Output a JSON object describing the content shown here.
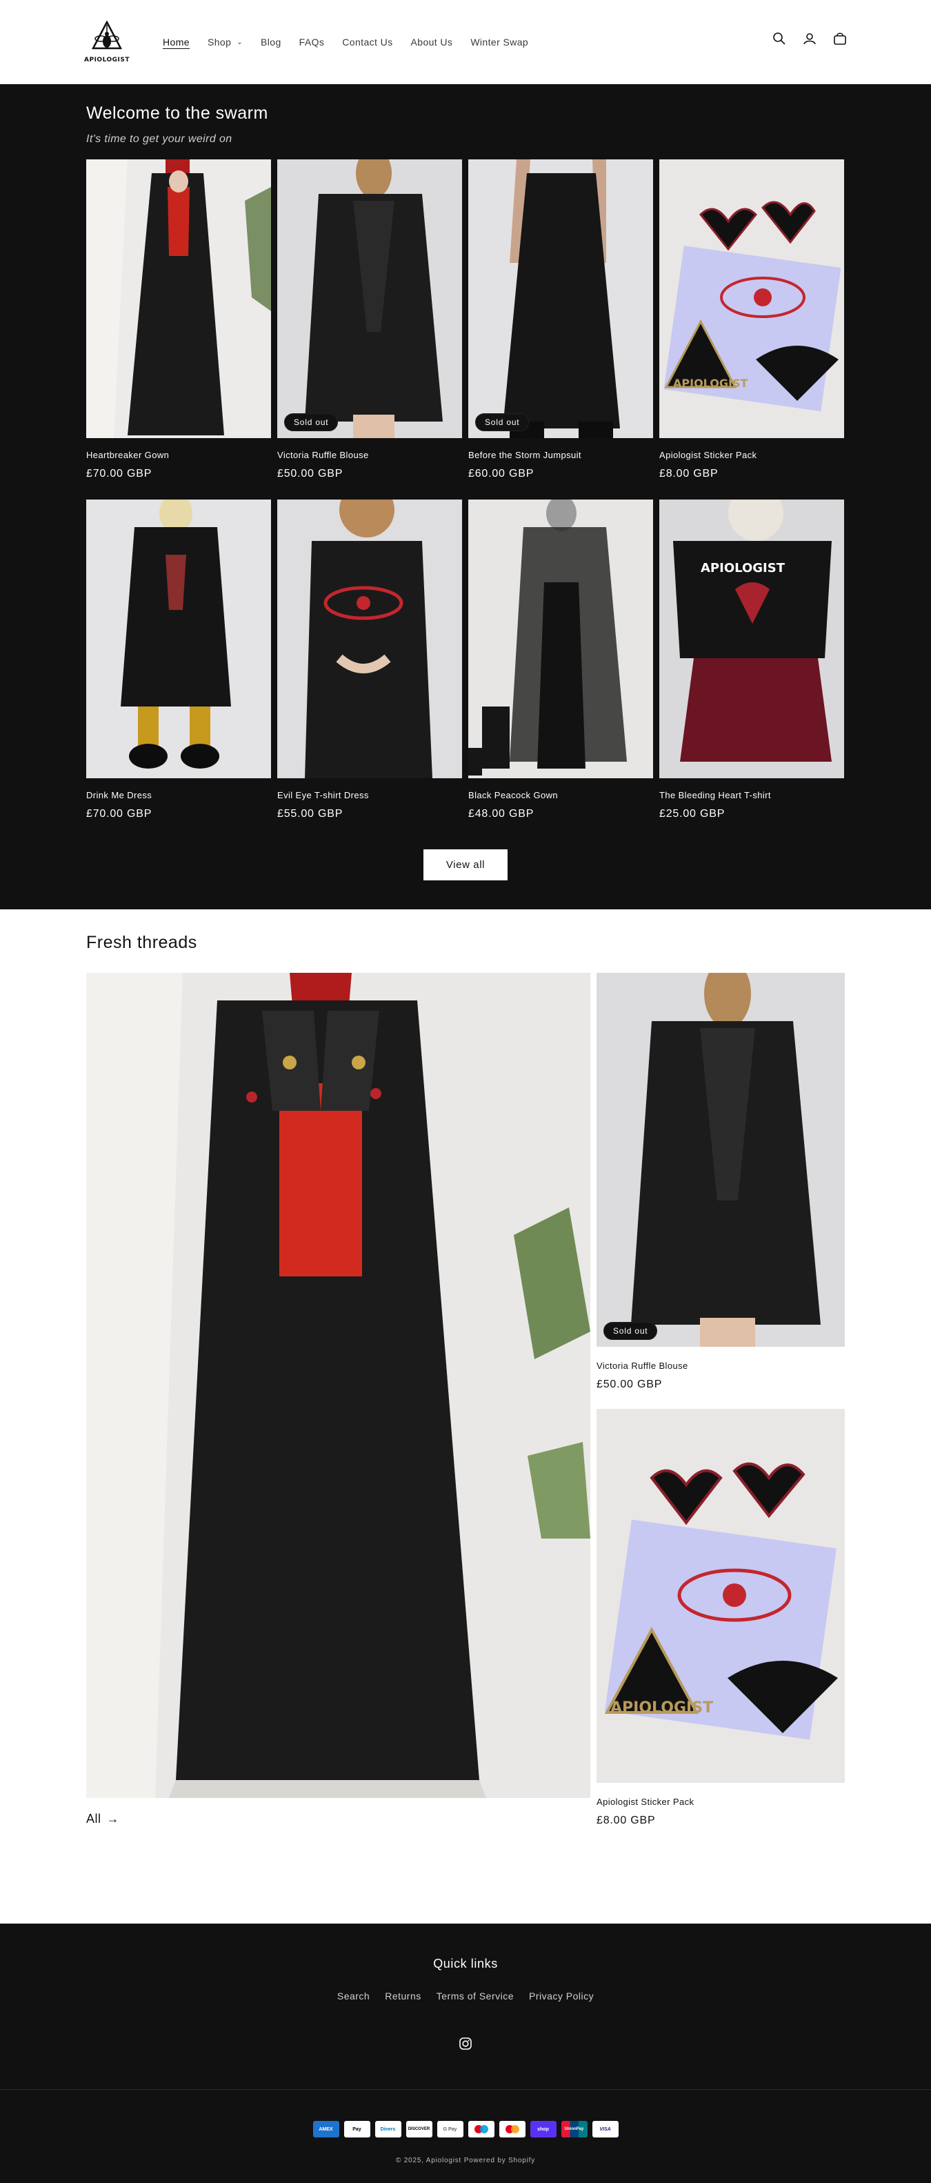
{
  "brand": {
    "logo_text": "APIOLOGIST"
  },
  "nav": {
    "items": [
      {
        "label": "Home"
      },
      {
        "label": "Shop"
      },
      {
        "label": "Blog"
      },
      {
        "label": "FAQs"
      },
      {
        "label": "Contact Us"
      },
      {
        "label": "About Us"
      },
      {
        "label": "Winter Swap"
      }
    ],
    "icons": [
      "search-icon",
      "account-icon",
      "cart-icon"
    ]
  },
  "featured": {
    "title": "Welcome to the swarm",
    "subtitle": "It's time to get your weird on",
    "products": [
      {
        "title": "Heartbreaker Gown",
        "price": "£70.00 GBP",
        "badge": ""
      },
      {
        "title": "Victoria Ruffle Blouse",
        "price": "£50.00 GBP",
        "badge": "Sold out"
      },
      {
        "title": "Before the Storm Jumpsuit",
        "price": "£60.00 GBP",
        "badge": "Sold out"
      },
      {
        "title": "Apiologist Sticker Pack",
        "price": "£8.00 GBP",
        "badge": ""
      },
      {
        "title": "Drink Me Dress",
        "price": "£70.00 GBP",
        "badge": ""
      },
      {
        "title": "Evil Eye T-shirt Dress",
        "price": "£55.00 GBP",
        "badge": ""
      },
      {
        "title": "Black Peacock Gown",
        "price": "£48.00 GBP",
        "badge": ""
      },
      {
        "title": "The Bleeding Heart T-shirt",
        "price": "£25.00 GBP",
        "badge": ""
      }
    ],
    "view_all": "View all"
  },
  "fresh": {
    "title": "Fresh threads",
    "all_link": "All",
    "products": [
      {
        "title": "Victoria Ruffle Blouse",
        "price": "£50.00 GBP",
        "badge": "Sold out"
      },
      {
        "title": "Apiologist Sticker Pack",
        "price": "£8.00 GBP",
        "badge": ""
      }
    ]
  },
  "footer": {
    "quick_links_title": "Quick links",
    "links": [
      "Search",
      "Returns",
      "Terms of Service",
      "Privacy Policy"
    ],
    "payment_methods": [
      {
        "name": "AMEX",
        "color": "#1f72cd"
      },
      {
        "name": "Pay",
        "color": "#ffffff"
      },
      {
        "name": "Diners",
        "color": "#ffffff"
      },
      {
        "name": "DISCOVER",
        "color": "#ffffff"
      },
      {
        "name": "G Pay",
        "color": "#ffffff"
      },
      {
        "name": "maestro",
        "color": "#ffffff"
      },
      {
        "name": "master",
        "color": "#ffffff"
      },
      {
        "name": "shop",
        "color": "#5a31f4"
      },
      {
        "name": "UnionPay",
        "color": "#e21836"
      },
      {
        "name": "VISA",
        "color": "#ffffff"
      }
    ],
    "copyright": "© 2025, Apiologist Powered by Shopify"
  }
}
